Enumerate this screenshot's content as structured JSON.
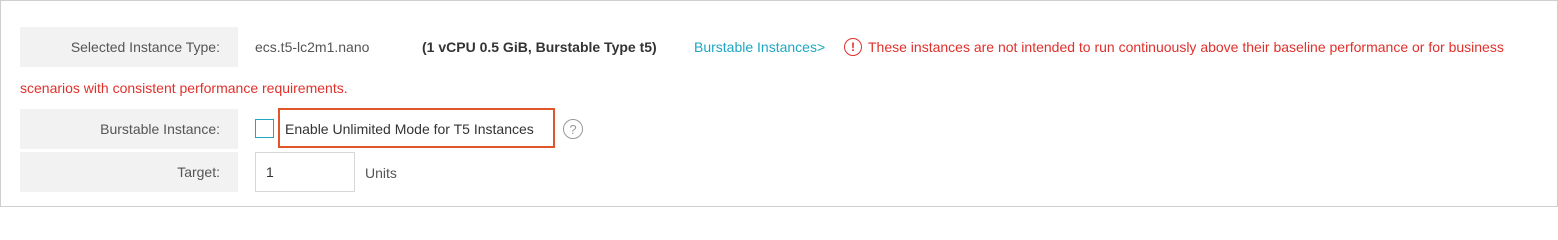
{
  "instance_type": {
    "label": "Selected Instance Type:",
    "value": "ecs.t5-lc2m1.nano",
    "spec": "(1 vCPU 0.5 GiB, Burstable Type t5)",
    "link": "Burstable Instances>",
    "warning_icon": "!",
    "warning_line1": "These instances are not intended to run continuously above their baseline performance or for business",
    "warning_line2": "scenarios with consistent performance requirements."
  },
  "burstable": {
    "label": "Burstable Instance:",
    "checkbox_label": "Enable Unlimited Mode for T5 Instances",
    "checked": false,
    "help_icon": "?"
  },
  "target": {
    "label": "Target:",
    "value": "1",
    "units": "Units"
  },
  "colors": {
    "accent": "#1fa6c2",
    "warning": "#e0302b",
    "highlight": "#e0562b"
  }
}
